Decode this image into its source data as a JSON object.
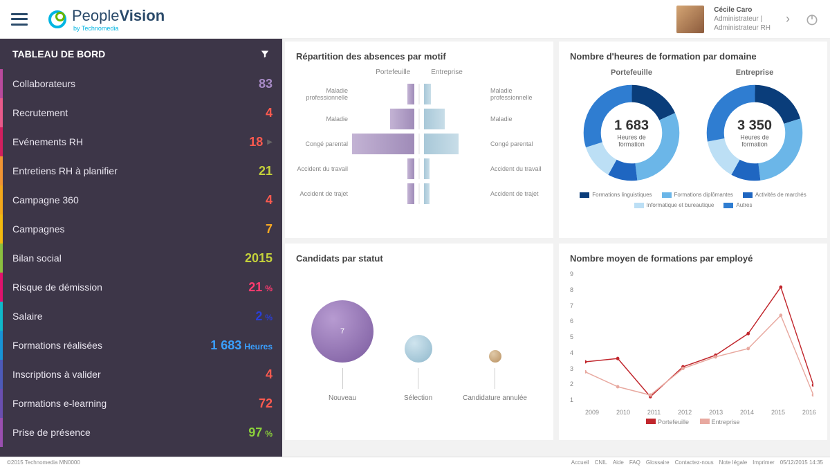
{
  "header": {
    "brand_a": "People",
    "brand_b": "Vision",
    "brand_sub": "by Technomedia",
    "user_name": "Cécile Caro",
    "user_role1": "Administrateur |",
    "user_role2": "Administrateur RH"
  },
  "sidebar": {
    "title": "TABLEAU DE BORD",
    "items": [
      {
        "label": "Collaborateurs",
        "value": "83",
        "color": "#a88bc7",
        "accent": "#b94a9c"
      },
      {
        "label": "Recrutement",
        "value": "4",
        "color": "#ff5a4f",
        "accent": "#e85a8a"
      },
      {
        "label": "Evénements RH",
        "value": "18",
        "color": "#ff5a4f",
        "accent": "#d21f5f",
        "chev": true
      },
      {
        "label": "Entretiens RH à planifier",
        "value": "21",
        "color": "#c4d13a",
        "accent": "#f09433"
      },
      {
        "label": "Campagne 360",
        "value": "4",
        "color": "#ff5a4f",
        "accent": "#f2a71b"
      },
      {
        "label": "Campagnes",
        "value": "7",
        "color": "#f7a823",
        "accent": "#f2b90f"
      },
      {
        "label": "Bilan social",
        "value": "2015",
        "color": "#c4d13a",
        "accent": "#8bbf3f"
      },
      {
        "label": "Risque de démission",
        "value": "21",
        "unit": "%",
        "color": "#ff3b6f",
        "accent": "#e0126d"
      },
      {
        "label": "Salaire",
        "value": "2",
        "unit": "%",
        "color": "#2a3fd6",
        "accent": "#10b8c9"
      },
      {
        "label": "Formations réalisées",
        "value": "1 683",
        "unit": "Heures",
        "color": "#3aa0ff",
        "accent": "#1893d6"
      },
      {
        "label": "Inscriptions à valider",
        "value": "4",
        "color": "#ff5a4f",
        "accent": "#4d5ab8"
      },
      {
        "label": "Formations e-learning",
        "value": "72",
        "color": "#ff5a4f",
        "accent": "#6a4fb0"
      },
      {
        "label": "Prise de présence",
        "value": "97",
        "unit": "%",
        "color": "#8bd13a",
        "accent": "#9a4fb0"
      }
    ]
  },
  "panels": {
    "absences_title": "Répartition des absences par motif",
    "donuts_title": "Nombre d'heures de formation par domaine",
    "candidates_title": "Candidats par statut",
    "line_title": "Nombre moyen de formations par employé"
  },
  "absences": {
    "cols": [
      "Portefeuille",
      "Entreprise"
    ],
    "rows": [
      "Maladie professionnelle",
      "Maladie",
      "Congé parental",
      "Accident du travail",
      "Accident de trajet"
    ]
  },
  "donuts": {
    "left_title": "Portefeuille",
    "right_title": "Entreprise",
    "left_value": "1 683",
    "right_value": "3 350",
    "sub": "Heures de formation",
    "legend": [
      "Formations linguistiques",
      "Formations diplômantes",
      "Activités de marchés",
      "Informatique et bureautique",
      "Autres"
    ],
    "colors": [
      "#0a3d7a",
      "#6bb6e8",
      "#1f66c1",
      "#bcdff5",
      "#2f7dd1"
    ]
  },
  "candidates": {
    "labels": [
      "Nouveau",
      "Sélection",
      "Candidature annulée"
    ],
    "center": "7"
  },
  "footer": {
    "copyright": "©2015 Technomedia MN0000",
    "links": [
      "Accueil",
      "CNIL",
      "Aide",
      "FAQ",
      "Glossaire",
      "Contactez-nous",
      "Note légale",
      "Imprimer"
    ],
    "date": "05/12/2015 14:35"
  },
  "chart_data": [
    {
      "type": "bar",
      "title": "Répartition des absences par motif",
      "categories": [
        "Maladie professionnelle",
        "Maladie",
        "Congé parental",
        "Accident du travail",
        "Accident de trajet"
      ],
      "series": [
        {
          "name": "Portefeuille",
          "values": [
            10,
            35,
            90,
            10,
            10
          ]
        },
        {
          "name": "Entreprise",
          "values": [
            10,
            30,
            50,
            8,
            8
          ]
        }
      ]
    },
    {
      "type": "pie",
      "title": "Nombre d'heures de formation par domaine",
      "series": [
        {
          "name": "Portefeuille",
          "total": 1683,
          "slices": [
            {
              "label": "Formations linguistiques",
              "value": 18
            },
            {
              "label": "Formations diplômantes",
              "value": 30
            },
            {
              "label": "Activités de marchés",
              "value": 10
            },
            {
              "label": "Informatique et bureautique",
              "value": 12
            },
            {
              "label": "Autres",
              "value": 30
            }
          ]
        },
        {
          "name": "Entreprise",
          "total": 3350,
          "slices": [
            {
              "label": "Formations linguistiques",
              "value": 20
            },
            {
              "label": "Formations diplômantes",
              "value": 28
            },
            {
              "label": "Activités de marchés",
              "value": 10
            },
            {
              "label": "Informatique et bureautique",
              "value": 14
            },
            {
              "label": "Autres",
              "value": 28
            }
          ]
        }
      ]
    },
    {
      "type": "line",
      "title": "Nombre moyen de formations par employé",
      "x": [
        2009,
        2010,
        2011,
        2012,
        2013,
        2014,
        2015,
        2016
      ],
      "series": [
        {
          "name": "Portefeuille",
          "values": [
            3.5,
            3.7,
            1.4,
            3.2,
            3.9,
            5.2,
            8.0,
            2.1
          ],
          "color": "#c1272d"
        },
        {
          "name": "Entreprise",
          "values": [
            2.9,
            2.0,
            1.5,
            3.1,
            3.8,
            4.3,
            6.3,
            1.5
          ],
          "color": "#e8a9a0"
        }
      ],
      "ylim": [
        1,
        9
      ]
    }
  ]
}
